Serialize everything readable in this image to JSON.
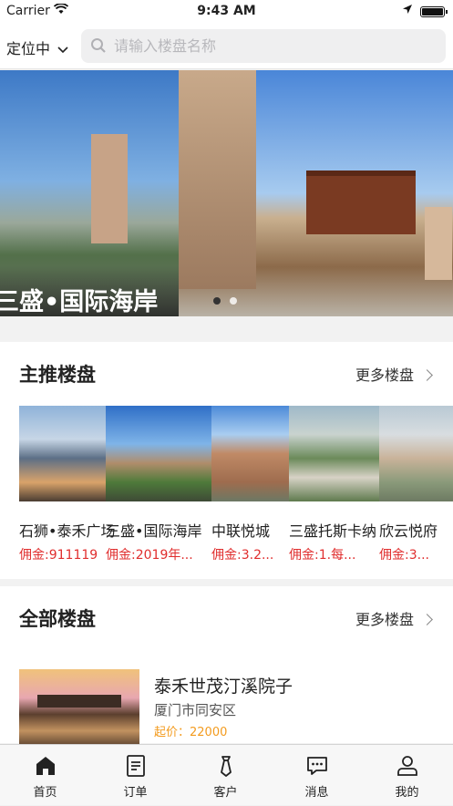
{
  "status_bar": {
    "carrier": "Carrier",
    "time": "9:43 AM"
  },
  "navbar": {
    "location_label": "定位中",
    "search_placeholder": "请输入楼盘名称"
  },
  "banner": {
    "caption": "三盛•国际海岸"
  },
  "featured": {
    "title": "主推楼盘",
    "more_label": "更多楼盘",
    "cards": [
      {
        "name": "石狮•泰禾广场",
        "commission": "佣金:911119"
      },
      {
        "name": "三盛•国际海岸",
        "commission": "佣金:2019年..."
      },
      {
        "name": "中联悦城",
        "commission": "佣金:3.2..."
      },
      {
        "name": "三盛托斯卡纳",
        "commission": "佣金:1.每..."
      },
      {
        "name": "欣云悦府",
        "commission": "佣金:3..."
      }
    ]
  },
  "all": {
    "title": "全部楼盘",
    "more_label": "更多楼盘",
    "items": [
      {
        "name": "泰禾世茂汀溪院子",
        "area": "厦门市同安区",
        "price": "起价：22000"
      }
    ]
  },
  "tabbar": {
    "items": [
      {
        "label": "首页",
        "icon": "home-icon"
      },
      {
        "label": "订单",
        "icon": "order-icon"
      },
      {
        "label": "客户",
        "icon": "customer-icon"
      },
      {
        "label": "消息",
        "icon": "message-icon"
      },
      {
        "label": "我的",
        "icon": "profile-icon"
      }
    ]
  },
  "colors": {
    "commission": "#e02e2e",
    "price": "#f39b1e",
    "accent_text": "#222222"
  }
}
